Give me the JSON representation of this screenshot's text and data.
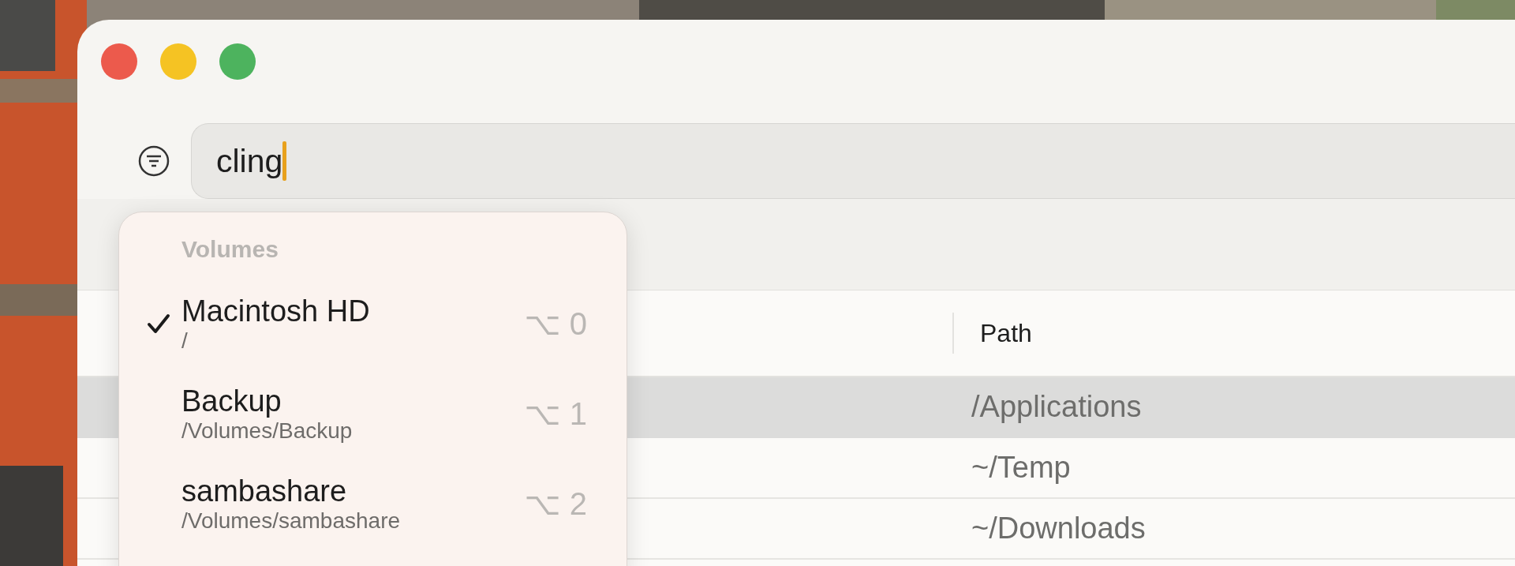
{
  "search": {
    "value": "cling"
  },
  "table": {
    "columns": [
      {
        "label": "Path"
      }
    ],
    "rows": [
      {
        "path": "/Applications",
        "selected": true
      },
      {
        "path": "~/Temp",
        "selected": false
      },
      {
        "path": "~/Downloads",
        "selected": false
      }
    ]
  },
  "volume_menu": {
    "heading": "Volumes",
    "items": [
      {
        "name": "Macintosh HD",
        "path": "/",
        "shortcut": "⌥ 0",
        "checked": true
      },
      {
        "name": "Backup",
        "path": "/Volumes/Backup",
        "shortcut": "⌥ 1",
        "checked": false
      },
      {
        "name": "sambashare",
        "path": "/Volumes/sambashare",
        "shortcut": "⌥ 2",
        "checked": false
      }
    ]
  }
}
